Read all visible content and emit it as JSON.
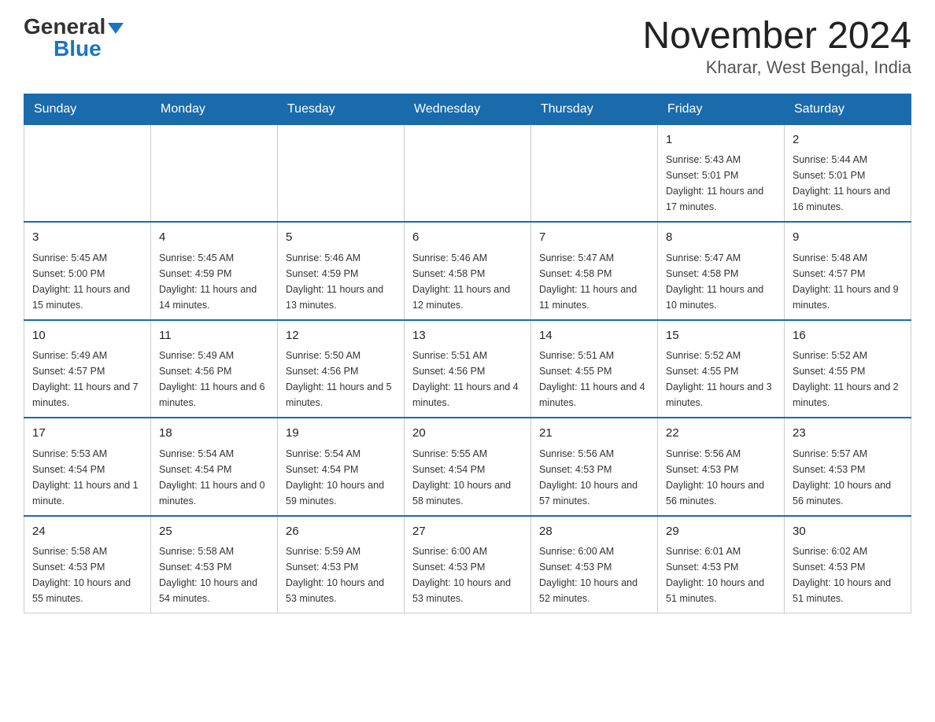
{
  "logo": {
    "general": "General",
    "blue": "Blue",
    "triangle": "▶"
  },
  "title": "November 2024",
  "subtitle": "Kharar, West Bengal, India",
  "days_of_week": [
    "Sunday",
    "Monday",
    "Tuesday",
    "Wednesday",
    "Thursday",
    "Friday",
    "Saturday"
  ],
  "weeks": [
    [
      {
        "day": "",
        "info": ""
      },
      {
        "day": "",
        "info": ""
      },
      {
        "day": "",
        "info": ""
      },
      {
        "day": "",
        "info": ""
      },
      {
        "day": "",
        "info": ""
      },
      {
        "day": "1",
        "info": "Sunrise: 5:43 AM\nSunset: 5:01 PM\nDaylight: 11 hours and 17 minutes."
      },
      {
        "day": "2",
        "info": "Sunrise: 5:44 AM\nSunset: 5:01 PM\nDaylight: 11 hours and 16 minutes."
      }
    ],
    [
      {
        "day": "3",
        "info": "Sunrise: 5:45 AM\nSunset: 5:00 PM\nDaylight: 11 hours and 15 minutes."
      },
      {
        "day": "4",
        "info": "Sunrise: 5:45 AM\nSunset: 4:59 PM\nDaylight: 11 hours and 14 minutes."
      },
      {
        "day": "5",
        "info": "Sunrise: 5:46 AM\nSunset: 4:59 PM\nDaylight: 11 hours and 13 minutes."
      },
      {
        "day": "6",
        "info": "Sunrise: 5:46 AM\nSunset: 4:58 PM\nDaylight: 11 hours and 12 minutes."
      },
      {
        "day": "7",
        "info": "Sunrise: 5:47 AM\nSunset: 4:58 PM\nDaylight: 11 hours and 11 minutes."
      },
      {
        "day": "8",
        "info": "Sunrise: 5:47 AM\nSunset: 4:58 PM\nDaylight: 11 hours and 10 minutes."
      },
      {
        "day": "9",
        "info": "Sunrise: 5:48 AM\nSunset: 4:57 PM\nDaylight: 11 hours and 9 minutes."
      }
    ],
    [
      {
        "day": "10",
        "info": "Sunrise: 5:49 AM\nSunset: 4:57 PM\nDaylight: 11 hours and 7 minutes."
      },
      {
        "day": "11",
        "info": "Sunrise: 5:49 AM\nSunset: 4:56 PM\nDaylight: 11 hours and 6 minutes."
      },
      {
        "day": "12",
        "info": "Sunrise: 5:50 AM\nSunset: 4:56 PM\nDaylight: 11 hours and 5 minutes."
      },
      {
        "day": "13",
        "info": "Sunrise: 5:51 AM\nSunset: 4:56 PM\nDaylight: 11 hours and 4 minutes."
      },
      {
        "day": "14",
        "info": "Sunrise: 5:51 AM\nSunset: 4:55 PM\nDaylight: 11 hours and 4 minutes."
      },
      {
        "day": "15",
        "info": "Sunrise: 5:52 AM\nSunset: 4:55 PM\nDaylight: 11 hours and 3 minutes."
      },
      {
        "day": "16",
        "info": "Sunrise: 5:52 AM\nSunset: 4:55 PM\nDaylight: 11 hours and 2 minutes."
      }
    ],
    [
      {
        "day": "17",
        "info": "Sunrise: 5:53 AM\nSunset: 4:54 PM\nDaylight: 11 hours and 1 minute."
      },
      {
        "day": "18",
        "info": "Sunrise: 5:54 AM\nSunset: 4:54 PM\nDaylight: 11 hours and 0 minutes."
      },
      {
        "day": "19",
        "info": "Sunrise: 5:54 AM\nSunset: 4:54 PM\nDaylight: 10 hours and 59 minutes."
      },
      {
        "day": "20",
        "info": "Sunrise: 5:55 AM\nSunset: 4:54 PM\nDaylight: 10 hours and 58 minutes."
      },
      {
        "day": "21",
        "info": "Sunrise: 5:56 AM\nSunset: 4:53 PM\nDaylight: 10 hours and 57 minutes."
      },
      {
        "day": "22",
        "info": "Sunrise: 5:56 AM\nSunset: 4:53 PM\nDaylight: 10 hours and 56 minutes."
      },
      {
        "day": "23",
        "info": "Sunrise: 5:57 AM\nSunset: 4:53 PM\nDaylight: 10 hours and 56 minutes."
      }
    ],
    [
      {
        "day": "24",
        "info": "Sunrise: 5:58 AM\nSunset: 4:53 PM\nDaylight: 10 hours and 55 minutes."
      },
      {
        "day": "25",
        "info": "Sunrise: 5:58 AM\nSunset: 4:53 PM\nDaylight: 10 hours and 54 minutes."
      },
      {
        "day": "26",
        "info": "Sunrise: 5:59 AM\nSunset: 4:53 PM\nDaylight: 10 hours and 53 minutes."
      },
      {
        "day": "27",
        "info": "Sunrise: 6:00 AM\nSunset: 4:53 PM\nDaylight: 10 hours and 53 minutes."
      },
      {
        "day": "28",
        "info": "Sunrise: 6:00 AM\nSunset: 4:53 PM\nDaylight: 10 hours and 52 minutes."
      },
      {
        "day": "29",
        "info": "Sunrise: 6:01 AM\nSunset: 4:53 PM\nDaylight: 10 hours and 51 minutes."
      },
      {
        "day": "30",
        "info": "Sunrise: 6:02 AM\nSunset: 4:53 PM\nDaylight: 10 hours and 51 minutes."
      }
    ]
  ]
}
